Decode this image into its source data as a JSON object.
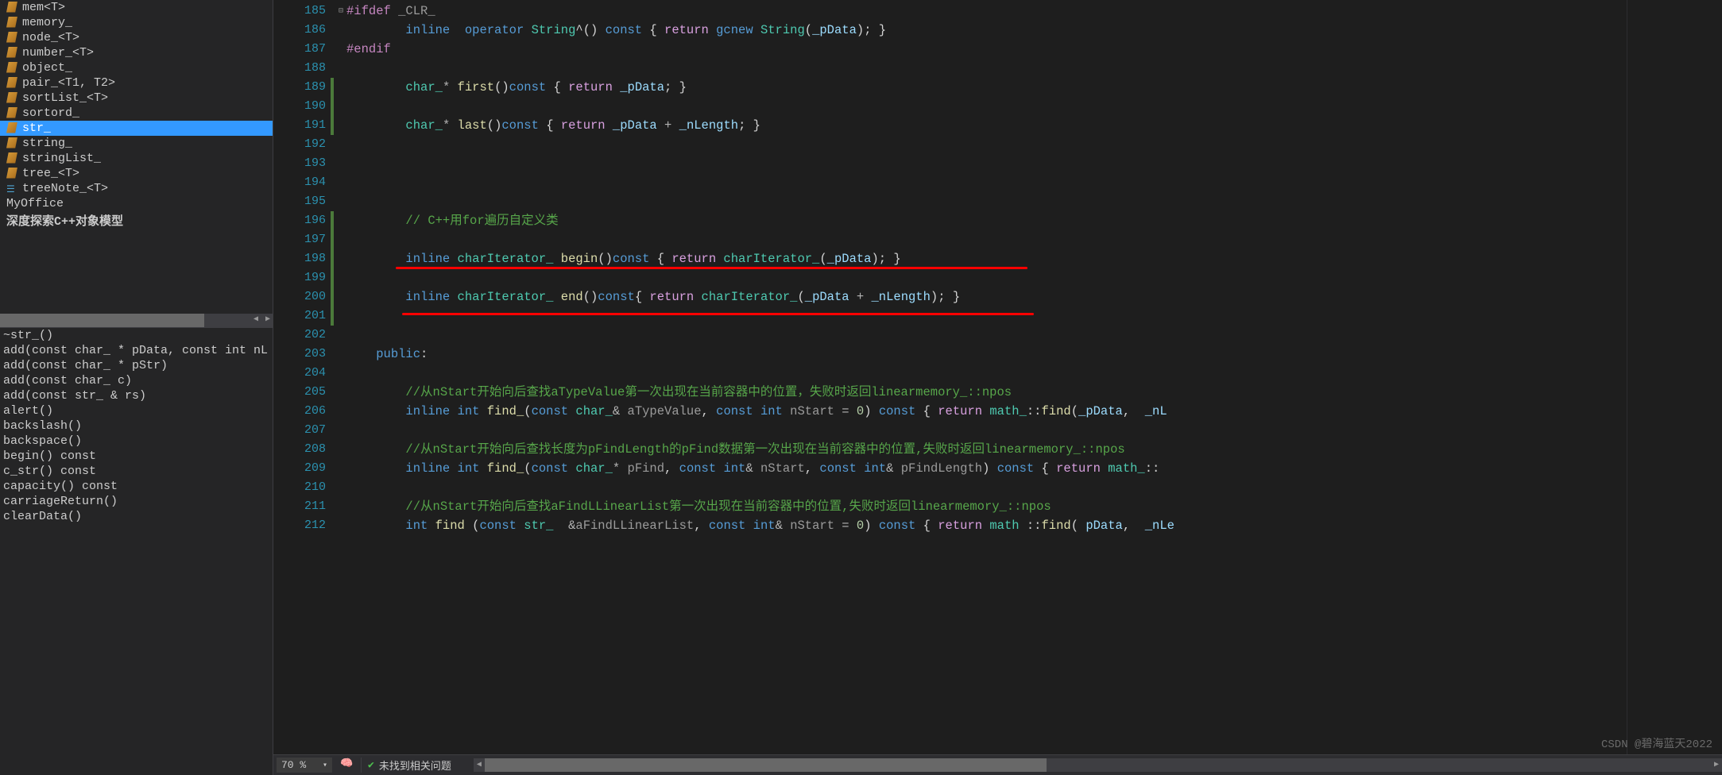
{
  "classView": {
    "items": [
      {
        "label": "mem<T>",
        "icon": "class"
      },
      {
        "label": "memory_",
        "icon": "class"
      },
      {
        "label": "node_<T>",
        "icon": "class"
      },
      {
        "label": "number_<T>",
        "icon": "class"
      },
      {
        "label": "object_",
        "icon": "class"
      },
      {
        "label": "pair_<T1, T2>",
        "icon": "class"
      },
      {
        "label": "sortList_<T>",
        "icon": "class"
      },
      {
        "label": "sortord_",
        "icon": "class"
      },
      {
        "label": "str_",
        "icon": "class",
        "selected": true
      },
      {
        "label": "string_",
        "icon": "class"
      },
      {
        "label": "stringList_",
        "icon": "class"
      },
      {
        "label": "tree_<T>",
        "icon": "class"
      },
      {
        "label": "treeNote_<T>",
        "icon": "note"
      },
      {
        "label": "MyOffice",
        "icon": "none"
      },
      {
        "label": "深度探索C++对象模型",
        "icon": "none",
        "bold": true
      }
    ]
  },
  "membersView": {
    "items": [
      "~str_()",
      "add(const char_ * pData, const int nL",
      "add(const char_ * pStr)",
      "add(const char_ c)",
      "add(const str_ & rs)",
      "alert()",
      "backslash()",
      "backspace()",
      "begin() const",
      "c_str() const",
      "capacity() const",
      "carriageReturn()",
      "clearData()"
    ]
  },
  "lineNumbers": [
    "185",
    "186",
    "187",
    "188",
    "189",
    "190",
    "191",
    "192",
    "193",
    "194",
    "195",
    "196",
    "197",
    "198",
    "199",
    "200",
    "201",
    "202",
    "203",
    "204",
    "205",
    "206",
    "207",
    "208",
    "209",
    "210",
    "211",
    "212"
  ],
  "code": {
    "l185": {
      "pp": "#ifdef",
      "sym": " _CLR_"
    },
    "l186": {
      "kw1": "inline",
      "sp1": "  ",
      "kw2": "operator",
      "type": " String",
      "op1": "^()",
      "kw3": " const",
      "brace1": " { ",
      "ret": "return",
      "fn": " gcnew",
      "type2": " String",
      "p1": "(",
      "var": "_pData",
      "p2": "); }"
    },
    "l187": {
      "pp": "#endif"
    },
    "l189": {
      "type": "char_",
      "op": "* ",
      "fn": "first",
      "paren": "()",
      "kw": "const",
      "brace": " { ",
      "ret": "return",
      "sp": " ",
      "var": "_pData",
      "end": "; }"
    },
    "l191": {
      "type": "char_",
      "op": "* ",
      "fn": "last",
      "paren": "()",
      "kw": "const",
      "brace": " { ",
      "ret": "return",
      "sp": " ",
      "var1": "_pData",
      "plus": " + ",
      "var2": "_nLength",
      "end": "; }"
    },
    "l196": {
      "com": "// C++用for遍历自定义类"
    },
    "l198": {
      "kw": "inline",
      "type": " charIterator_",
      "fn": " begin",
      "paren": "()",
      "kw2": "const",
      "brace": " { ",
      "ret": "return",
      "type2": " charIterator_",
      "p1": "(",
      "var": "_pData",
      "p2": "); }"
    },
    "l200": {
      "kw": "inline",
      "type": " charIterator_",
      "fn": " end",
      "paren": "()",
      "kw2": "const",
      "brace": "{ ",
      "ret": "return",
      "type2": " charIterator_",
      "p1": "(",
      "var1": "_pData",
      "plus": " + ",
      "var2": "_nLength",
      "p2": "); }"
    },
    "l203": {
      "kw": "public",
      "colon": ":"
    },
    "l205": {
      "com": "//从nStart开始向后查找aTypeValue第一次出现在当前容器中的位置，失败时返回linearmemory_::npos"
    },
    "l206": {
      "kw": "inline",
      "type": " int",
      "fn": " find_",
      "p1": "(",
      "kw2": "const",
      "type2": " char_",
      "amp": "& ",
      "var": "aTypeValue",
      "comma": ", ",
      "kw3": "const",
      "type3": " int",
      "var2": " nStart",
      "eq": " = ",
      "num": "0",
      "p2": ") ",
      "kw4": "const",
      "brace": " { ",
      "ret": "return",
      "type4": " math_",
      "scope": "::",
      "fn2": "find",
      "p3": "(",
      "var3": "_pData",
      "comma2": ",  ",
      "var4": "_nL"
    },
    "l208": {
      "com": "//从nStart开始向后查找长度为pFindLength的pFind数据第一次出现在当前容器中的位置,失败时返回linearmemory_::npos"
    },
    "l209": {
      "kw": "inline",
      "type": " int",
      "fn": " find_",
      "p1": "(",
      "kw2": "const",
      "type2": " char_",
      "star": "* ",
      "var": "pFind",
      "comma": ", ",
      "kw3": "const",
      "type3": " int",
      "amp": "& ",
      "var2": "nStart",
      "comma2": ", ",
      "kw4": "const",
      "type4": " int",
      "amp2": "& ",
      "var3": "pFindLength",
      "p2": ") ",
      "kw5": "const",
      "brace": " { ",
      "ret": "return",
      "type5": " math_",
      "scope": "::"
    },
    "l211": {
      "com": "//从nStart开始向后查找aFindLLinearList第一次出现在当前容器中的位置,失败时返回linearmemory_::npos"
    },
    "l212": {
      "type": "int",
      "fn": " find ",
      "p1": "(",
      "kw": "const",
      "type2": " str_",
      "sp": "  ",
      "amp": "&",
      "var": "aFindLLinearList",
      "comma": ", ",
      "kw2": "const",
      "type3": " int",
      "amp2": "& ",
      "var2": "nStart",
      "eq": " = ",
      "num": "0",
      "p2": ") ",
      "kw3": "const",
      "brace": " { ",
      "ret": "return",
      "type4": " math ",
      "scope": "::",
      "fn2": "find",
      "p3": "( ",
      "var3": "pData",
      "comma2": ",  ",
      "var4": "_nLe"
    }
  },
  "statusBar": {
    "zoom": "70 %",
    "issues": "未找到相关问题"
  },
  "watermark": "CSDN @碧海蓝天2022",
  "chart_data": {
    "type": "table",
    "note": "This is a code editor screenshot, not a chart"
  }
}
